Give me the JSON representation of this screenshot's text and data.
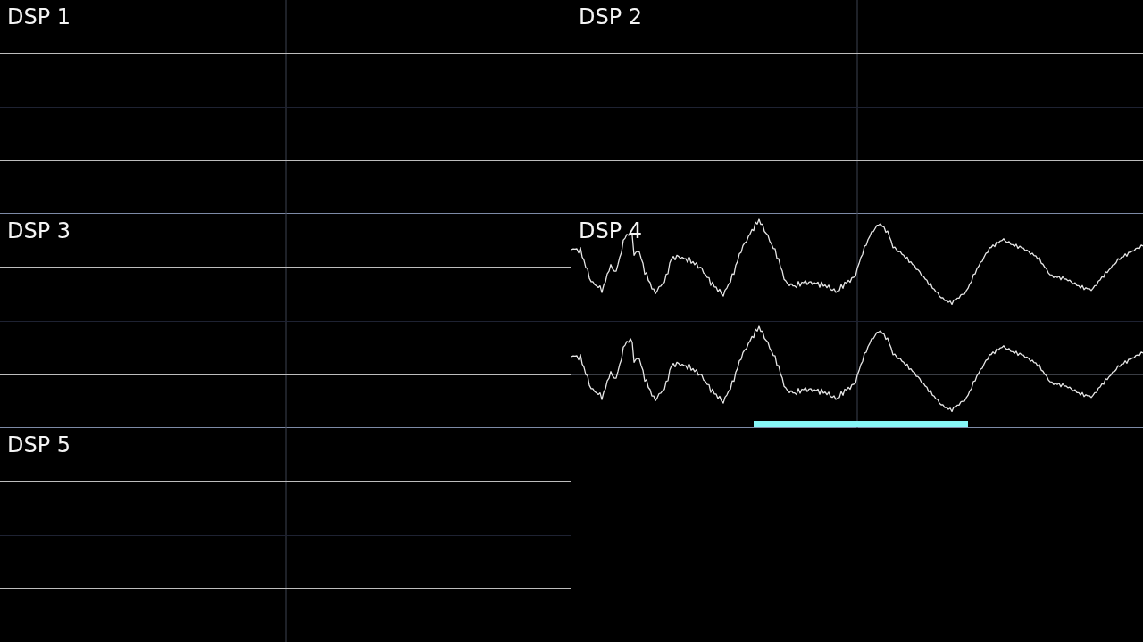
{
  "panels": [
    {
      "label": "DSP 1",
      "kind": "silent"
    },
    {
      "label": "DSP 2",
      "kind": "silent"
    },
    {
      "label": "DSP 3",
      "kind": "silent"
    },
    {
      "label": "DSP 4",
      "kind": "signal"
    },
    {
      "label": "DSP 5",
      "kind": "silent"
    }
  ]
}
